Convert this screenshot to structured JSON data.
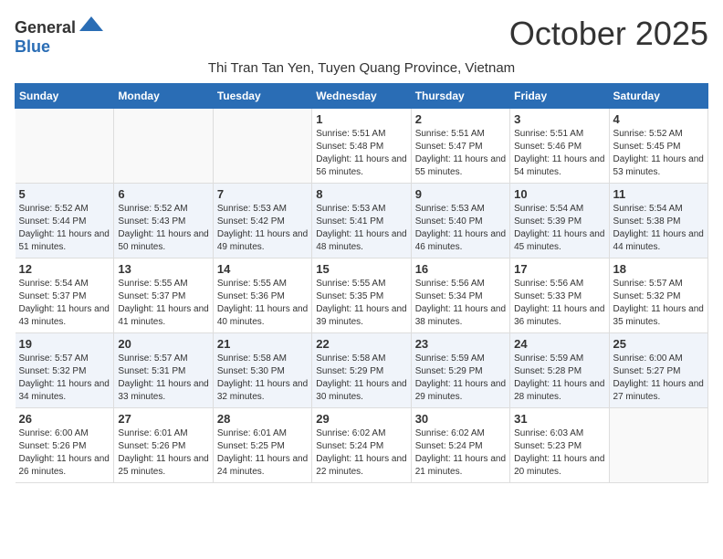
{
  "logo": {
    "general": "General",
    "blue": "Blue"
  },
  "title": "October 2025",
  "location": "Thi Tran Tan Yen, Tuyen Quang Province, Vietnam",
  "days_of_week": [
    "Sunday",
    "Monday",
    "Tuesday",
    "Wednesday",
    "Thursday",
    "Friday",
    "Saturday"
  ],
  "weeks": [
    [
      {
        "day": "",
        "sunrise": "",
        "sunset": "",
        "daylight": ""
      },
      {
        "day": "",
        "sunrise": "",
        "sunset": "",
        "daylight": ""
      },
      {
        "day": "",
        "sunrise": "",
        "sunset": "",
        "daylight": ""
      },
      {
        "day": "1",
        "sunrise": "Sunrise: 5:51 AM",
        "sunset": "Sunset: 5:48 PM",
        "daylight": "Daylight: 11 hours and 56 minutes."
      },
      {
        "day": "2",
        "sunrise": "Sunrise: 5:51 AM",
        "sunset": "Sunset: 5:47 PM",
        "daylight": "Daylight: 11 hours and 55 minutes."
      },
      {
        "day": "3",
        "sunrise": "Sunrise: 5:51 AM",
        "sunset": "Sunset: 5:46 PM",
        "daylight": "Daylight: 11 hours and 54 minutes."
      },
      {
        "day": "4",
        "sunrise": "Sunrise: 5:52 AM",
        "sunset": "Sunset: 5:45 PM",
        "daylight": "Daylight: 11 hours and 53 minutes."
      }
    ],
    [
      {
        "day": "5",
        "sunrise": "Sunrise: 5:52 AM",
        "sunset": "Sunset: 5:44 PM",
        "daylight": "Daylight: 11 hours and 51 minutes."
      },
      {
        "day": "6",
        "sunrise": "Sunrise: 5:52 AM",
        "sunset": "Sunset: 5:43 PM",
        "daylight": "Daylight: 11 hours and 50 minutes."
      },
      {
        "day": "7",
        "sunrise": "Sunrise: 5:53 AM",
        "sunset": "Sunset: 5:42 PM",
        "daylight": "Daylight: 11 hours and 49 minutes."
      },
      {
        "day": "8",
        "sunrise": "Sunrise: 5:53 AM",
        "sunset": "Sunset: 5:41 PM",
        "daylight": "Daylight: 11 hours and 48 minutes."
      },
      {
        "day": "9",
        "sunrise": "Sunrise: 5:53 AM",
        "sunset": "Sunset: 5:40 PM",
        "daylight": "Daylight: 11 hours and 46 minutes."
      },
      {
        "day": "10",
        "sunrise": "Sunrise: 5:54 AM",
        "sunset": "Sunset: 5:39 PM",
        "daylight": "Daylight: 11 hours and 45 minutes."
      },
      {
        "day": "11",
        "sunrise": "Sunrise: 5:54 AM",
        "sunset": "Sunset: 5:38 PM",
        "daylight": "Daylight: 11 hours and 44 minutes."
      }
    ],
    [
      {
        "day": "12",
        "sunrise": "Sunrise: 5:54 AM",
        "sunset": "Sunset: 5:37 PM",
        "daylight": "Daylight: 11 hours and 43 minutes."
      },
      {
        "day": "13",
        "sunrise": "Sunrise: 5:55 AM",
        "sunset": "Sunset: 5:37 PM",
        "daylight": "Daylight: 11 hours and 41 minutes."
      },
      {
        "day": "14",
        "sunrise": "Sunrise: 5:55 AM",
        "sunset": "Sunset: 5:36 PM",
        "daylight": "Daylight: 11 hours and 40 minutes."
      },
      {
        "day": "15",
        "sunrise": "Sunrise: 5:55 AM",
        "sunset": "Sunset: 5:35 PM",
        "daylight": "Daylight: 11 hours and 39 minutes."
      },
      {
        "day": "16",
        "sunrise": "Sunrise: 5:56 AM",
        "sunset": "Sunset: 5:34 PM",
        "daylight": "Daylight: 11 hours and 38 minutes."
      },
      {
        "day": "17",
        "sunrise": "Sunrise: 5:56 AM",
        "sunset": "Sunset: 5:33 PM",
        "daylight": "Daylight: 11 hours and 36 minutes."
      },
      {
        "day": "18",
        "sunrise": "Sunrise: 5:57 AM",
        "sunset": "Sunset: 5:32 PM",
        "daylight": "Daylight: 11 hours and 35 minutes."
      }
    ],
    [
      {
        "day": "19",
        "sunrise": "Sunrise: 5:57 AM",
        "sunset": "Sunset: 5:32 PM",
        "daylight": "Daylight: 11 hours and 34 minutes."
      },
      {
        "day": "20",
        "sunrise": "Sunrise: 5:57 AM",
        "sunset": "Sunset: 5:31 PM",
        "daylight": "Daylight: 11 hours and 33 minutes."
      },
      {
        "day": "21",
        "sunrise": "Sunrise: 5:58 AM",
        "sunset": "Sunset: 5:30 PM",
        "daylight": "Daylight: 11 hours and 32 minutes."
      },
      {
        "day": "22",
        "sunrise": "Sunrise: 5:58 AM",
        "sunset": "Sunset: 5:29 PM",
        "daylight": "Daylight: 11 hours and 30 minutes."
      },
      {
        "day": "23",
        "sunrise": "Sunrise: 5:59 AM",
        "sunset": "Sunset: 5:29 PM",
        "daylight": "Daylight: 11 hours and 29 minutes."
      },
      {
        "day": "24",
        "sunrise": "Sunrise: 5:59 AM",
        "sunset": "Sunset: 5:28 PM",
        "daylight": "Daylight: 11 hours and 28 minutes."
      },
      {
        "day": "25",
        "sunrise": "Sunrise: 6:00 AM",
        "sunset": "Sunset: 5:27 PM",
        "daylight": "Daylight: 11 hours and 27 minutes."
      }
    ],
    [
      {
        "day": "26",
        "sunrise": "Sunrise: 6:00 AM",
        "sunset": "Sunset: 5:26 PM",
        "daylight": "Daylight: 11 hours and 26 minutes."
      },
      {
        "day": "27",
        "sunrise": "Sunrise: 6:01 AM",
        "sunset": "Sunset: 5:26 PM",
        "daylight": "Daylight: 11 hours and 25 minutes."
      },
      {
        "day": "28",
        "sunrise": "Sunrise: 6:01 AM",
        "sunset": "Sunset: 5:25 PM",
        "daylight": "Daylight: 11 hours and 24 minutes."
      },
      {
        "day": "29",
        "sunrise": "Sunrise: 6:02 AM",
        "sunset": "Sunset: 5:24 PM",
        "daylight": "Daylight: 11 hours and 22 minutes."
      },
      {
        "day": "30",
        "sunrise": "Sunrise: 6:02 AM",
        "sunset": "Sunset: 5:24 PM",
        "daylight": "Daylight: 11 hours and 21 minutes."
      },
      {
        "day": "31",
        "sunrise": "Sunrise: 6:03 AM",
        "sunset": "Sunset: 5:23 PM",
        "daylight": "Daylight: 11 hours and 20 minutes."
      },
      {
        "day": "",
        "sunrise": "",
        "sunset": "",
        "daylight": ""
      }
    ]
  ]
}
